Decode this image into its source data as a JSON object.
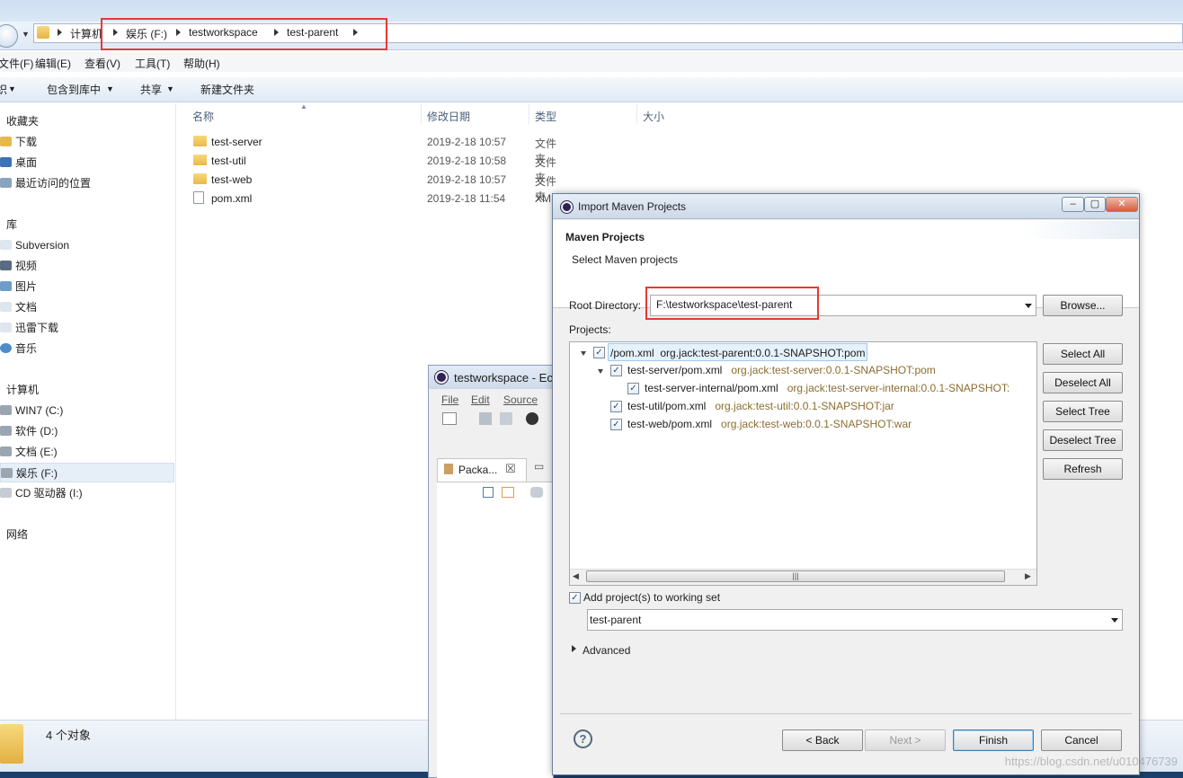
{
  "explorer": {
    "breadcrumb": [
      "计算机",
      "娱乐 (F:)",
      "testworkspace",
      "test-parent"
    ],
    "menu": [
      "文件(F)",
      "编辑(E)",
      "查看(V)",
      "工具(T)",
      "帮助(H)"
    ],
    "commands": [
      "组织",
      "包含到库中",
      "共享",
      "新建文件夹"
    ],
    "nav": {
      "favorites": "收藏夹",
      "fav_items": [
        "下载",
        "桌面",
        "最近访问的位置"
      ],
      "libraries": "库",
      "lib_items": [
        "Subversion",
        "视频",
        "图片",
        "文档",
        "迅雷下载",
        "音乐"
      ],
      "computer": "计算机",
      "drives": [
        "WIN7 (C:)",
        "软件 (D:)",
        "文档 (E:)",
        "娱乐 (F:)",
        "CD 驱动器 (I:)"
      ],
      "network": "网络"
    },
    "columns": [
      "名称",
      "修改日期",
      "类型",
      "大小"
    ],
    "files": [
      {
        "name": "test-server",
        "date": "2019-2-18 10:57",
        "type": "文件夹"
      },
      {
        "name": "test-util",
        "date": "2019-2-18 10:58",
        "type": "文件夹"
      },
      {
        "name": "test-web",
        "date": "2019-2-18 10:57",
        "type": "文件夹"
      },
      {
        "name": "pom.xml",
        "date": "2019-2-18 11:54",
        "type": "XM"
      }
    ],
    "status": "4 个对象"
  },
  "eclipse": {
    "title": "testworkspace - Ec",
    "menu": [
      "File",
      "Edit",
      "Source"
    ],
    "view_tab": "Packa..."
  },
  "dialog": {
    "title": "Import Maven Projects",
    "heading": "Maven Projects",
    "subheading": "Select Maven projects",
    "root_label": "Root Directory:",
    "root_value": "F:\\testworkspace\\test-parent",
    "browse": "Browse...",
    "projects_label": "Projects:",
    "tree": [
      {
        "path": "/pom.xml",
        "gav": "org.jack:test-parent:0.0.1-SNAPSHOT:pom"
      },
      {
        "path": "test-server/pom.xml",
        "gav": "org.jack:test-server:0.0.1-SNAPSHOT:pom"
      },
      {
        "path": "test-server-internal/pom.xml",
        "gav": "org.jack:test-server-internal:0.0.1-SNAPSHOT:"
      },
      {
        "path": "test-util/pom.xml",
        "gav": "org.jack:test-util:0.0.1-SNAPSHOT:jar"
      },
      {
        "path": "test-web/pom.xml",
        "gav": "org.jack:test-web:0.0.1-SNAPSHOT:war"
      }
    ],
    "side_buttons": [
      "Select All",
      "Deselect All",
      "Select Tree",
      "Deselect Tree",
      "Refresh"
    ],
    "add_to_ws": "Add project(s) to working set",
    "working_set": "test-parent",
    "advanced": "Advanced",
    "back": "< Back",
    "next": "Next >",
    "finish": "Finish",
    "cancel": "Cancel"
  },
  "watermark": "https://blog.csdn.net/u010476739"
}
